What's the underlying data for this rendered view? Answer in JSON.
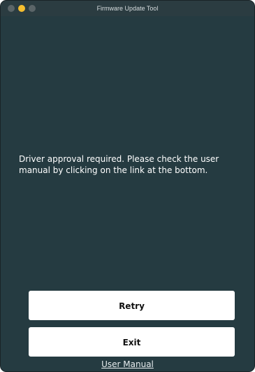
{
  "window": {
    "title": "Firmware Update Tool"
  },
  "message": {
    "text": "Driver approval required. Please check the user manual by clicking on the link at the bottom."
  },
  "buttons": {
    "retry_label": "Retry",
    "exit_label": "Exit"
  },
  "footer": {
    "user_manual_link": "User Manual"
  },
  "colors": {
    "background": "#253b41",
    "titlebar": "#2b3c41",
    "button_bg": "#ffffff",
    "text": "#ffffff",
    "minimize_button": "#f5be2f"
  }
}
